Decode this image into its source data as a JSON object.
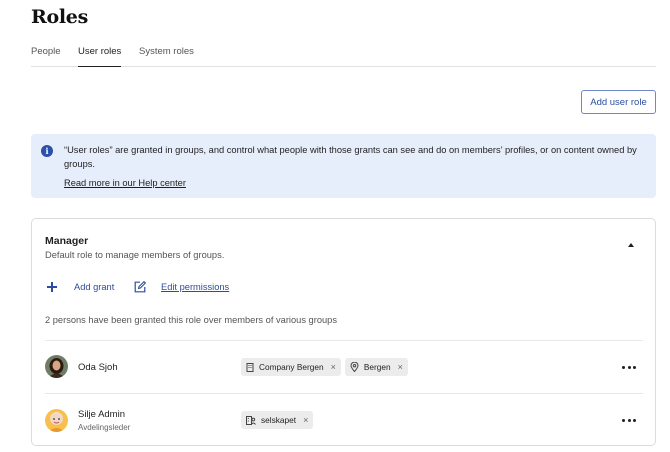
{
  "page": {
    "title": "Roles"
  },
  "tabs": [
    {
      "label": "People"
    },
    {
      "label": "User roles",
      "active": true
    },
    {
      "label": "System roles"
    }
  ],
  "actions": {
    "add_user_role": "Add user role"
  },
  "info": {
    "text": "“User roles” are granted in groups, and control what people with those grants can see and do on members’ profiles, or on content owned by groups.",
    "link": "Read more in our Help center"
  },
  "role": {
    "name": "Manager",
    "description": "Default role to manage members of groups.",
    "add_grant": "Add grant",
    "edit_permissions": "Edit permissions",
    "summary": "2 persons have been granted this role over members of various groups",
    "grants": [
      {
        "name": "Oda Sjoh",
        "title": "",
        "chips": [
          {
            "icon": "building-icon",
            "label": "Company Bergen"
          },
          {
            "icon": "location-pin-icon",
            "label": "Bergen"
          }
        ]
      },
      {
        "name": "Silje Admin",
        "title": "Avdelingsleder",
        "chips": [
          {
            "icon": "team-icon",
            "label": "selskapet"
          }
        ]
      }
    ]
  },
  "colors": {
    "accent": "#2b4d9f",
    "info_bg": "#e7eefb",
    "chip_bg": "#ececec"
  }
}
